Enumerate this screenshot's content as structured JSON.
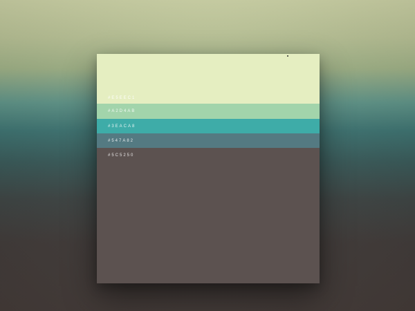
{
  "palette": {
    "swatches": [
      {
        "hex": "#E5EEC1",
        "label": "#E5EEC1"
      },
      {
        "hex": "#A2D4AB",
        "label": "#A2D4AB"
      },
      {
        "hex": "#3EACA8",
        "label": "#3EACA8"
      },
      {
        "hex": "#547A82",
        "label": "#547A82"
      },
      {
        "hex": "#5C5250",
        "label": "#5C5250"
      }
    ]
  }
}
